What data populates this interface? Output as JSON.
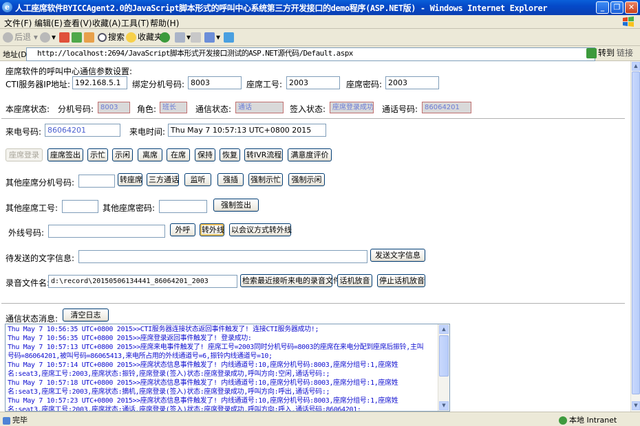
{
  "window": {
    "title": "人工座席软件BYICCAgent2.0的JavaScript脚本形式的呼叫中心系统第三方开发接口的demo程序(ASP.NET版) - Windows Internet Explorer",
    "ie_logo": "e"
  },
  "menu": [
    "文件(F)",
    "编辑(E)",
    "查看(V)",
    "收藏(A)",
    "工具(T)",
    "帮助(H)"
  ],
  "toolbar": {
    "back": "后退",
    "search": "搜索",
    "favorites": "收藏夹"
  },
  "address": {
    "label": "地址(D)",
    "url": "http://localhost:2694/JavaScript脚本形式开发接口测试的ASP.NET源代码/Default.aspx",
    "go": "转到",
    "links": "链接"
  },
  "form": {
    "heading": "座席软件的呼叫中心通信参数设置:",
    "cti_label": "CTI服务器IP地址:",
    "cti_value": "192.168.5.1",
    "bind_ext_label": "绑定分机号码:",
    "bind_ext_value": "8003",
    "agent_id_label": "座席工号:",
    "agent_id_value": "2003",
    "agent_pwd_label": "座席密码:",
    "agent_pwd_value": "2003",
    "status_label": "本座席状态:",
    "ext_label": "分机号码:",
    "ext_value": "8003",
    "role_label": "角色:",
    "role_value": "班长",
    "comm_label": "通信状态:",
    "comm_value": "通话",
    "signin_label": "签入状态:",
    "signin_value": "座席登录成功",
    "call_no_label": "通话号码:",
    "call_no_value": "86064201",
    "caller_label": "来电号码:",
    "caller_value": "86064201",
    "call_time_label": "来电时间:",
    "call_time_value": "Thu May 7 10:57:13 UTC+0800 2015",
    "buttons_row1": [
      "座席登录",
      "座席签出",
      "示忙",
      "示闲",
      "离席",
      "在席",
      "保持",
      "恢复",
      "转IVR流程",
      "满意度评价"
    ],
    "other_ext_label": "其他座席分机号码:",
    "other_ext_value": "",
    "buttons_row2": [
      "转座席",
      "三方通话",
      "监听",
      "强插",
      "强制示忙",
      "强制示闲"
    ],
    "other_id_label": "其他座席工号:",
    "other_id_value": "",
    "other_pwd_label": "其他座席密码:",
    "other_pwd_value": "",
    "force_logout": "强制签出",
    "outline_label": "外线号码:",
    "outline_value": "",
    "outcall": "外呼",
    "transfer_out": "转外线",
    "conf_transfer": "以会议方式转外线",
    "text_msg_label": "待发送的文字信息:",
    "text_msg_value": "",
    "send_text": "发送文字信息",
    "record_label": "录音文件名:",
    "record_value": "d:\\record\\20150506134441_86064201_2003",
    "search_record": "检索最近接听来电的录音文件",
    "play_record": "话机放音",
    "stop_play": "停止话机放音",
    "log_label": "通信状态消息:",
    "clear_log": "清空日志"
  },
  "log_lines": [
    "Thu May 7 10:56:35 UTC+0800 2015>>CTI服务器连接状态返回事件触发了! 连接CTI服务器成功!;",
    "Thu May 7 10:56:35 UTC+0800 2015>>座席登录返回事件触发了! 登录成功:",
    "Thu May 7 10:57:13 UTC+0800 2015>>座席来电事件触发了! 座席工号=2003同时分机号码=8003的座席在来电分配到座席后振铃,主叫",
    "号码=86064201,被叫号码=86065413,来电所占用的外线通道号=6,振铃内线通道号=10;",
    "Thu May 7 10:57:14 UTC+0800 2015>>座席状态信息事件触发了! 内线通道号:10,座席分机号码:8003,座席分组号:1,座席姓",
    "名:seat3,座席工号:2003,座席状态:振铃,座席登录(签入)状态:座席登录成功,呼叫方向:空闲,通话号码:;",
    "Thu May 7 10:57:18 UTC+0800 2015>>座席状态信息事件触发了! 内线通道号:10,座席分机号码:8003,座席分组号:1,座席姓",
    "名:seat3,座席工号:2003,座席状态:摘机,座席登录(签入)状态:座席登录成功,呼叫方向:呼出,通话号码:;",
    "Thu May 7 10:57:23 UTC+0800 2015>>座席状态信息事件触发了! 内线通道号:10,座席分机号码:8003,座席分组号:1,座席姓",
    "名:seat3,座席工号:2003,座席状态:通话,座席登录(签入)状态:座席登录成功,呼叫方向:呼入,通话号码:86064201;"
  ],
  "status": {
    "left": "完毕",
    "zone": "本地 Intranet"
  },
  "colors": {
    "titlebar": "#0549C8",
    "chrome": "#ECE9D8",
    "log_text": "#1010D0",
    "readonly_text": "#6A7BD6"
  }
}
